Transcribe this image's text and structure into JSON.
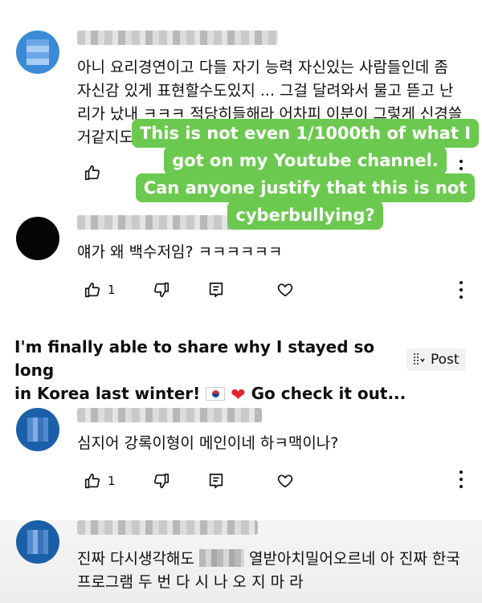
{
  "comments": [
    {
      "avatar": "lightblue",
      "text": "아니 요리경연이고 다들 자기 능력 자신있는 사람들인데 좀 자신감 있게 표현할수도있지 ... 그걸 달려와서 물고 뜯고 난리가 났내 ㅋㅋㅋ 적당히들해라 어차피 이분이 그렇게 신경쓸거같지도 않은데"
    },
    {
      "avatar": "black",
      "text": "얘가 왜 백수저임? ㅋㅋㅋㅋㅋㅋ",
      "likes": "1"
    },
    {
      "avatar": "blue",
      "text": "심지어 강록이형이 메인이네 하ㅋ맥이나?",
      "likes": "1"
    },
    {
      "avatar": "blue",
      "text_before": "진짜 다시생각해도",
      "text_after": "열받아치밀어오르네 아 진짜 한국프로그램 두 번 다 시 나 오 지 마 라"
    }
  ],
  "promo": {
    "text_line1": "I'm finally able to share why I stayed so long",
    "text_line2": "in Korea last winter!",
    "text_after": "Go check it out...",
    "flag_icon": "korea-flag-icon",
    "heart": "❤",
    "post_label": "Post"
  },
  "overlay": {
    "lines": [
      "This is not even 1/1000th of what I",
      "got on my Youtube channel.",
      "Can anyone justify that this is not",
      "cyberbullying?"
    ],
    "color": "#6cc94f"
  }
}
